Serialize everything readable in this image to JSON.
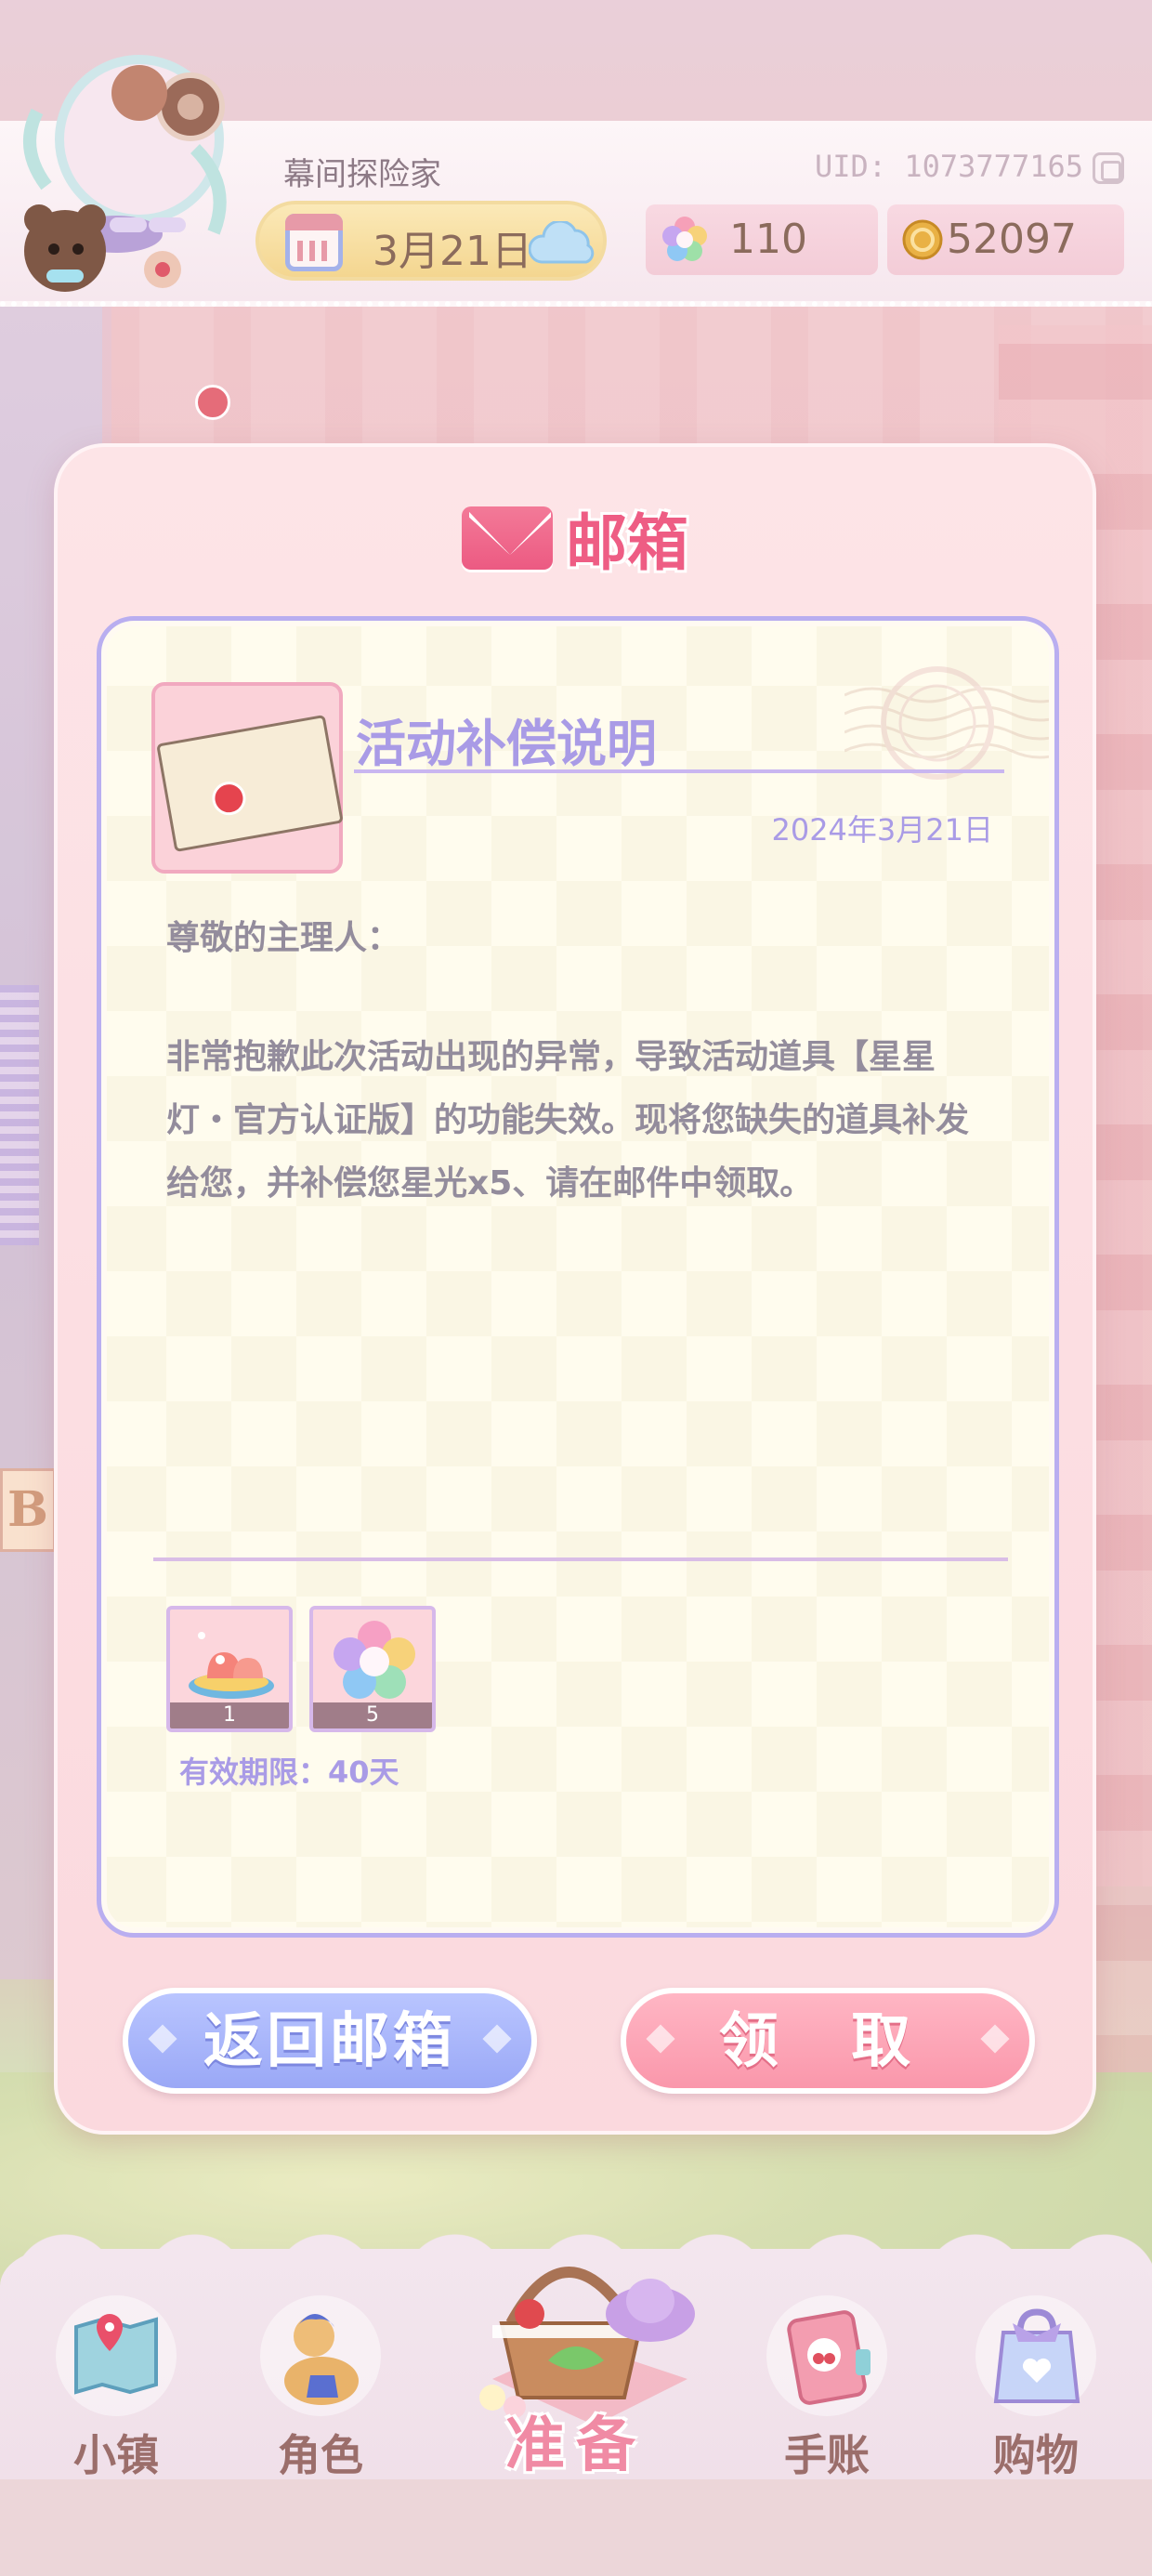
{
  "header": {
    "username": "幕间探险家",
    "uid": "UID: 1073777165",
    "date": "3月21日",
    "stars": "110",
    "coins": "52097",
    "icons": [
      "calendar-icon",
      "cloud-icon",
      "rainbow-star-icon",
      "coin-icon",
      "copy-icon"
    ]
  },
  "modal": {
    "title": "邮箱",
    "title_icon": "envelope-icon",
    "mail": {
      "subject": "活动补偿说明",
      "date": "2024年3月21日",
      "greeting": "尊敬的主理人：",
      "body": "非常抱歉此次活动出现的异常，导致活动道具【星星灯・官方认证版】的功能失效。现将您缺失的道具补发给您，并补偿您星光x5、请在邮件中领取。",
      "attachments": [
        {
          "name": "jelly-dessert-item",
          "quantity": "1"
        },
        {
          "name": "rainbow-star-item",
          "quantity": "5"
        }
      ],
      "expiry": "有效期限：40天"
    },
    "buttons": {
      "back": "返回邮箱",
      "claim": "领 取"
    }
  },
  "bottom_nav": {
    "town": "小镇",
    "role": "角色",
    "prepare": "准备",
    "journal": "手账",
    "shop": "购物"
  },
  "colors": {
    "accent_pink": "#ee5d84",
    "lavender": "#a99be6",
    "body_text": "#938c9c",
    "button_blue": "#9aa8f6",
    "button_pink": "#fa97ab"
  }
}
